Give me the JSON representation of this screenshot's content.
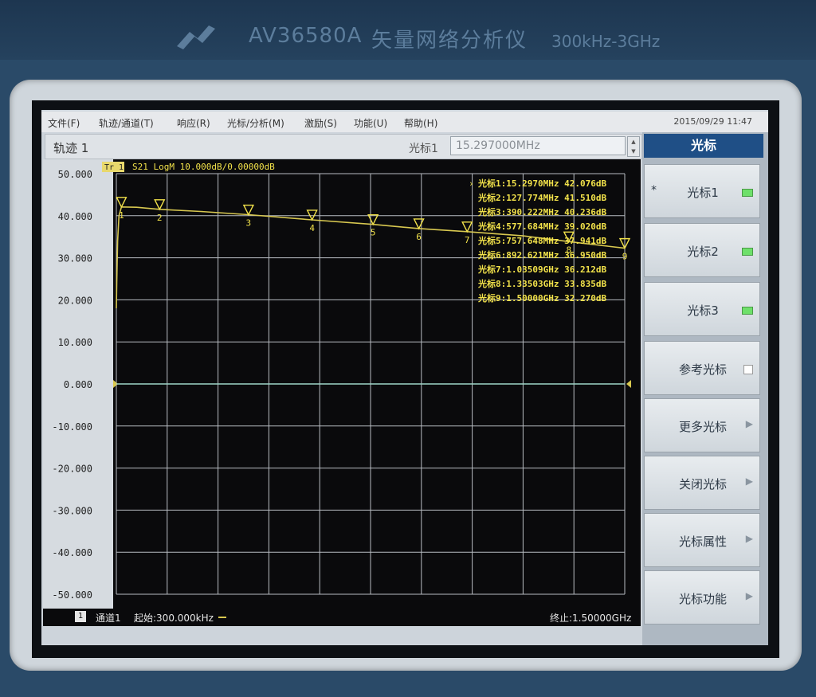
{
  "instrument": {
    "model": "AV36580A",
    "name": "矢量网络分析仪",
    "range": "300kHz-3GHz"
  },
  "menubar": {
    "items": [
      "文件(F)",
      "轨迹/通道(T)",
      "响应(R)",
      "光标/分析(M)",
      "激励(S)",
      "功能(U)",
      "帮助(H)"
    ],
    "datetime": "2015/09/29 11:47"
  },
  "trace_header": {
    "title": "轨迹 1",
    "marker_label": "光标1",
    "marker_value": "15.297000MHz"
  },
  "plot": {
    "trace_badge": "Tr 1",
    "trace_info": "S21 LogM 10.000dB/0.00000dB",
    "ref_value": "0.000",
    "colors": {
      "trace": "#d8c850",
      "reference": "#9ed6c8",
      "grid": "#b8bcc2",
      "marker_text": "#f2e24a"
    }
  },
  "markers_readout": [
    {
      "label": "光标1:15.2970MHz 42.076dB",
      "active": true
    },
    {
      "label": "光标2:127.774MHz 41.510dB"
    },
    {
      "label": "光标3:390.222MHz 40.236dB"
    },
    {
      "label": "光标4:577.684MHz 39.020dB"
    },
    {
      "label": "光标5:757.648MHz 37.941dB"
    },
    {
      "label": "光标6:892.621MHz 36.950dB"
    },
    {
      "label": "光标7:1.03509GHz 36.212dB"
    },
    {
      "label": "光标8:1.33503GHz 33.835dB"
    },
    {
      "label": "光标9:1.50000GHz 32.270dB"
    }
  ],
  "chart_data": {
    "type": "line",
    "title": "S21 LogM 10.000dB/0.00000dB",
    "x_unit": "GHz",
    "xlim": [
      0.0003,
      1.5
    ],
    "ylim": [
      -50,
      50
    ],
    "y_ticks": [
      "50.000",
      "40.000",
      "30.000",
      "20.000",
      "10.000",
      "0.000",
      "-10.000",
      "-20.000",
      "-30.000",
      "-40.000",
      "-50.000"
    ],
    "grid": true,
    "series": [
      {
        "x": [
          0.0003,
          0.0015,
          0.004,
          0.008,
          0.0153,
          0.06,
          0.1278,
          0.25,
          0.3902,
          0.5777,
          0.7576,
          0.8926,
          1.0351,
          1.2,
          1.335,
          1.5
        ],
        "values": [
          18,
          24,
          34,
          40,
          42.08,
          42.0,
          41.51,
          41.0,
          40.24,
          39.02,
          37.94,
          36.95,
          36.21,
          35.2,
          33.84,
          32.27
        ]
      },
      {
        "x": [
          0.0003,
          1.5
        ],
        "values": [
          0,
          0
        ]
      }
    ],
    "markers": [
      {
        "num": "1",
        "x": 0.0153,
        "y": 42.076
      },
      {
        "num": "2",
        "x": 0.1278,
        "y": 41.51
      },
      {
        "num": "3",
        "x": 0.3902,
        "y": 40.236
      },
      {
        "num": "4",
        "x": 0.5777,
        "y": 39.02
      },
      {
        "num": "5",
        "x": 0.7576,
        "y": 37.941
      },
      {
        "num": "6",
        "x": 0.8926,
        "y": 36.95
      },
      {
        "num": "7",
        "x": 1.0351,
        "y": 36.212
      },
      {
        "num": "8",
        "x": 1.335,
        "y": 33.835
      },
      {
        "num": "9",
        "x": 1.5,
        "y": 32.27
      }
    ]
  },
  "statusbar": {
    "channel_num": "1",
    "channel": "通道1",
    "start": "起始:300.000kHz",
    "stop": "终止:1.50000GHz"
  },
  "softkeys": {
    "title": "光标",
    "items": [
      {
        "label": "光标1",
        "mark": "led",
        "star": "*"
      },
      {
        "label": "光标2",
        "mark": "led"
      },
      {
        "label": "光标3",
        "mark": "led"
      },
      {
        "label": "参考光标",
        "mark": "box"
      },
      {
        "label": "更多光标",
        "mark": "arrow"
      },
      {
        "label": "关闭光标",
        "mark": "arrow"
      },
      {
        "label": "光标属性",
        "mark": "arrow"
      },
      {
        "label": "光标功能",
        "mark": "arrow"
      }
    ]
  }
}
